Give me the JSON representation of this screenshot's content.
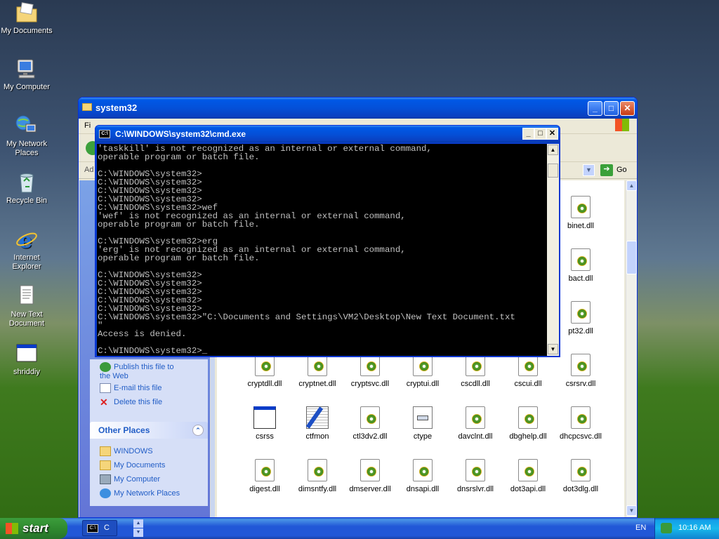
{
  "desktop": {
    "icons": [
      {
        "label": "My Documents",
        "icon": "folder-documents-icon"
      },
      {
        "label": "My Computer",
        "icon": "computer-icon"
      },
      {
        "label": "My Network Places",
        "icon": "network-icon"
      },
      {
        "label": "Recycle Bin",
        "icon": "recycle-bin-icon"
      },
      {
        "label": "Internet Explorer",
        "icon": "internet-explorer-icon"
      },
      {
        "label": "New Text Document",
        "icon": "text-document-icon"
      },
      {
        "label": "shriddiy",
        "icon": "application-icon"
      }
    ]
  },
  "explorer": {
    "title": "system32",
    "menu_hint": "Fi",
    "address_hint": "Ad",
    "go_label": "Go",
    "file_tasks": [
      {
        "label": "Publish this file to the Web",
        "icon": "publish-web-icon"
      },
      {
        "label": "E-mail this file",
        "icon": "email-icon"
      },
      {
        "label": "Delete this file",
        "icon": "delete-x-icon"
      }
    ],
    "other_places": {
      "title": "Other Places",
      "items": [
        {
          "label": "WINDOWS",
          "icon": "folder-icon"
        },
        {
          "label": "My Documents",
          "icon": "folder-documents-icon"
        },
        {
          "label": "My Computer",
          "icon": "computer-icon"
        },
        {
          "label": "My Network Places",
          "icon": "network-icon"
        }
      ]
    },
    "files": [
      {
        "name": "binet.dll",
        "icon": "dll-gear-icon"
      },
      {
        "name": "bact.dll",
        "icon": "dll-gear-icon"
      },
      {
        "name": "pt32.dll",
        "icon": "dll-gear-icon"
      },
      {
        "name": "cryptdll.dll",
        "icon": "dll-gear-icon"
      },
      {
        "name": "cryptnet.dll",
        "icon": "dll-gear-icon"
      },
      {
        "name": "cryptsvc.dll",
        "icon": "dll-gear-icon"
      },
      {
        "name": "cryptui.dll",
        "icon": "dll-gear-icon"
      },
      {
        "name": "cscdll.dll",
        "icon": "dll-gear-icon"
      },
      {
        "name": "cscui.dll",
        "icon": "dll-gear-icon"
      },
      {
        "name": "csrsrv.dll",
        "icon": "dll-gear-icon"
      },
      {
        "name": "csrss",
        "icon": "exe-window-icon"
      },
      {
        "name": "ctfmon",
        "icon": "ctfmon-pen-icon"
      },
      {
        "name": "ctl3dv2.dll",
        "icon": "dll-gear-icon"
      },
      {
        "name": "ctype",
        "icon": "document-icon"
      },
      {
        "name": "davclnt.dll",
        "icon": "dll-gear-icon"
      },
      {
        "name": "dbghelp.dll",
        "icon": "dll-gear-icon"
      },
      {
        "name": "dhcpcsvc.dll",
        "icon": "dll-gear-icon"
      },
      {
        "name": "digest.dll",
        "icon": "dll-gear-icon"
      },
      {
        "name": "dimsntfy.dll",
        "icon": "dll-gear-icon"
      },
      {
        "name": "dmserver.dll",
        "icon": "dll-gear-icon"
      },
      {
        "name": "dnsapi.dll",
        "icon": "dll-gear-icon"
      },
      {
        "name": "dnsrslvr.dll",
        "icon": "dll-gear-icon"
      },
      {
        "name": "dot3api.dll",
        "icon": "dll-gear-icon"
      },
      {
        "name": "dot3dlg.dll",
        "icon": "dll-gear-icon"
      }
    ]
  },
  "cmd": {
    "title": "C:\\WINDOWS\\system32\\cmd.exe",
    "output": "'taskkill' is not recognized as an internal or external command,\noperable program or batch file.\n\nC:\\WINDOWS\\system32>\nC:\\WINDOWS\\system32>\nC:\\WINDOWS\\system32>\nC:\\WINDOWS\\system32>\nC:\\WINDOWS\\system32>wef\n'wef' is not recognized as an internal or external command,\noperable program or batch file.\n\nC:\\WINDOWS\\system32>erg\n'erg' is not recognized as an internal or external command,\noperable program or batch file.\n\nC:\\WINDOWS\\system32>\nC:\\WINDOWS\\system32>\nC:\\WINDOWS\\system32>\nC:\\WINDOWS\\system32>\nC:\\WINDOWS\\system32>\nC:\\WINDOWS\\system32>\"C:\\Documents and Settings\\VM2\\Desktop\\New Text Document.txt\n\"\nAccess is denied.\n\nC:\\WINDOWS\\system32>_"
  },
  "taskbar": {
    "start_label": "start",
    "task_label": "C",
    "language": "EN",
    "clock": "10:16 AM"
  }
}
